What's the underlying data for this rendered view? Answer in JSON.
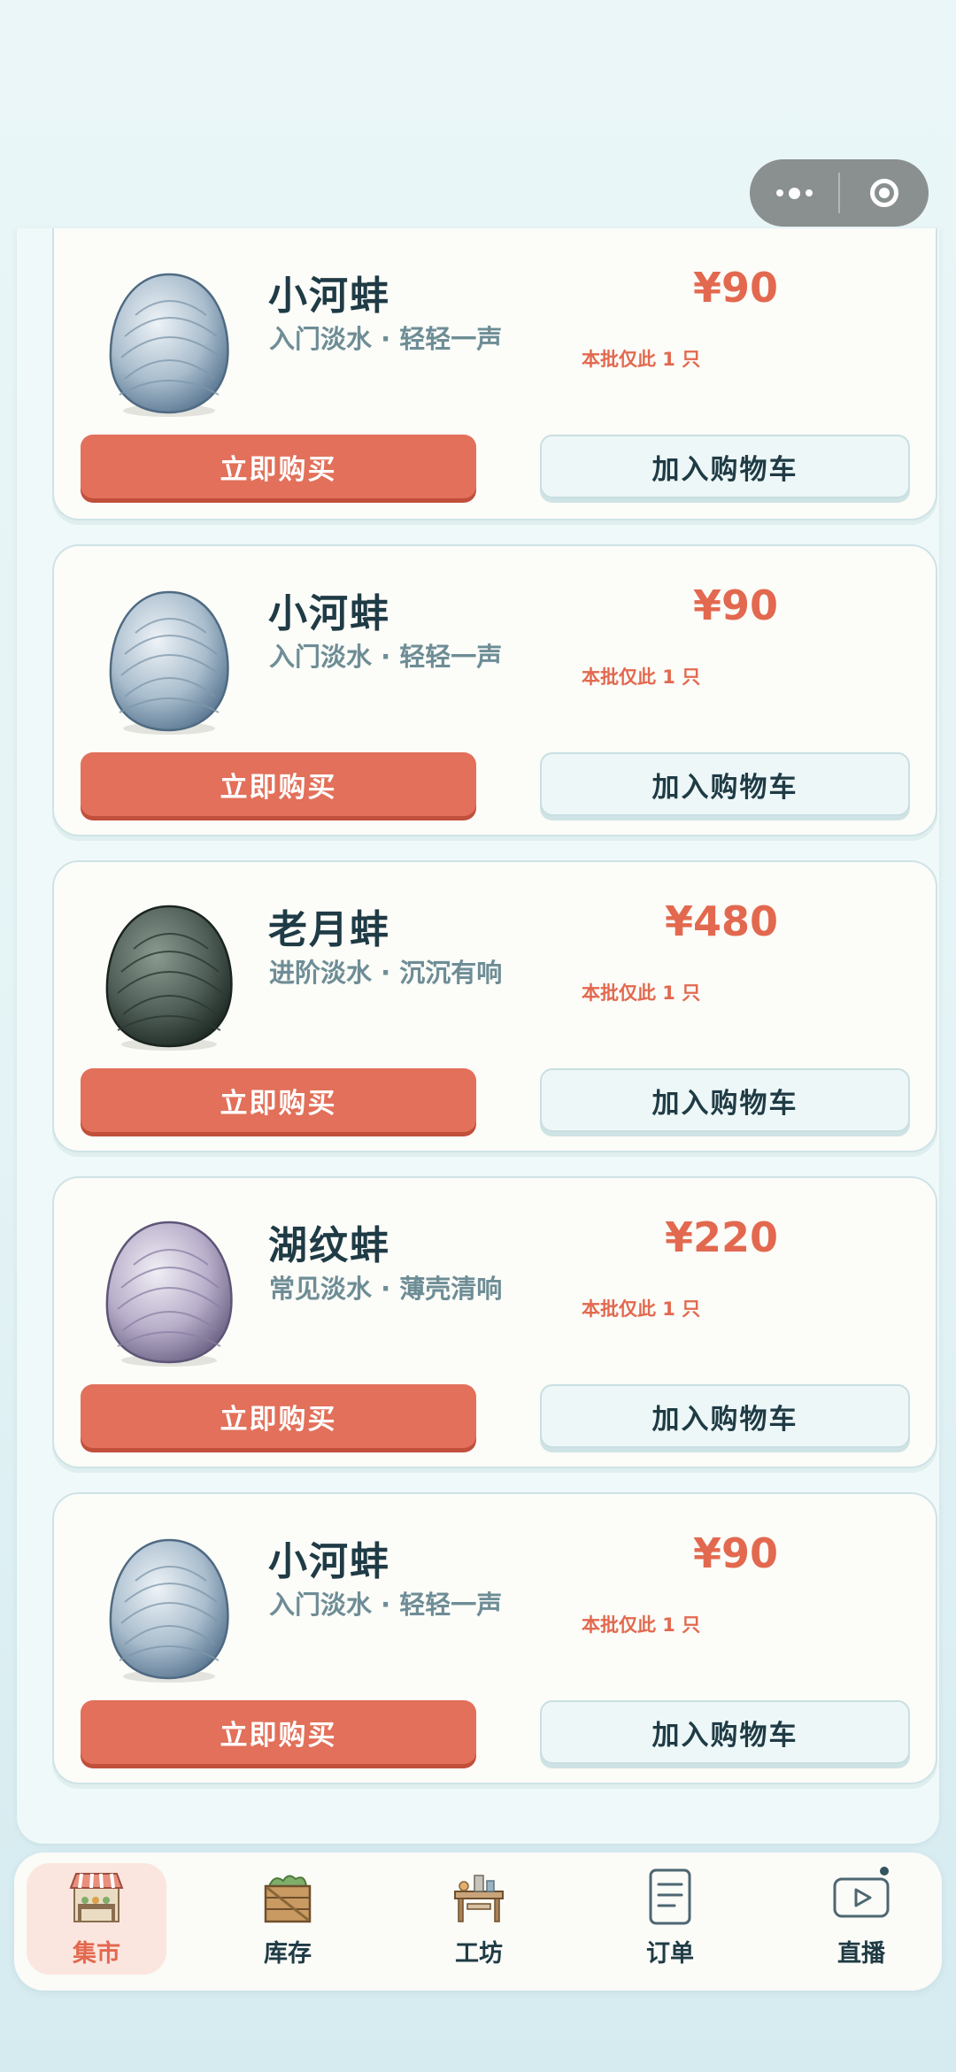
{
  "products": [
    {
      "name": "小河蚌",
      "desc": "入门淡水 · 轻轻一声",
      "price": "¥90",
      "stock": "本批仅此 1 只",
      "clam_icon": "pale-blue-clam-icon",
      "clam_colors": [
        "#eef3f7",
        "#a9bdcd",
        "#5b7893"
      ]
    },
    {
      "name": "小河蚌",
      "desc": "入门淡水 · 轻轻一声",
      "price": "¥90",
      "stock": "本批仅此 1 只",
      "clam_icon": "pale-blue-clam-icon",
      "clam_colors": [
        "#eef3f7",
        "#a9bdcd",
        "#5b7893"
      ]
    },
    {
      "name": "老月蚌",
      "desc": "进阶淡水 · 沉沉有响",
      "price": "¥480",
      "stock": "本批仅此 1 只",
      "clam_icon": "dark-clam-icon",
      "clam_colors": [
        "#8a9a90",
        "#4f5e57",
        "#1f2a25"
      ]
    },
    {
      "name": "湖纹蚌",
      "desc": "常见淡水 · 薄壳清响",
      "price": "¥220",
      "stock": "本批仅此 1 只",
      "clam_icon": "lavender-clam-icon",
      "clam_colors": [
        "#f1eef5",
        "#b7adc9",
        "#6e6587"
      ]
    },
    {
      "name": "小河蚌",
      "desc": "入门淡水 · 轻轻一声",
      "price": "¥90",
      "stock": "本批仅此 1 只",
      "clam_icon": "pale-blue-clam-icon",
      "clam_colors": [
        "#eef3f7",
        "#a9bdcd",
        "#5b7893"
      ]
    }
  ],
  "buttons": {
    "buy_now": "立即购买",
    "add_to_cart": "加入购物车"
  },
  "tabs": [
    {
      "label": "集市",
      "icon": "market-stall-icon",
      "active": true
    },
    {
      "label": "库存",
      "icon": "crate-icon",
      "active": false
    },
    {
      "label": "工坊",
      "icon": "workbench-icon",
      "active": false
    },
    {
      "label": "订单",
      "icon": "document-icon",
      "active": false
    },
    {
      "label": "直播",
      "icon": "play-video-icon",
      "active": false
    }
  ],
  "capsule": {
    "menu_icon": "more-dots-icon",
    "close_icon": "target-circle-icon"
  },
  "colors": {
    "accent": "#e2694f",
    "buy_button": "#e2705a",
    "text_dark": "#1f3b45",
    "text_muted": "#6e8d96"
  }
}
